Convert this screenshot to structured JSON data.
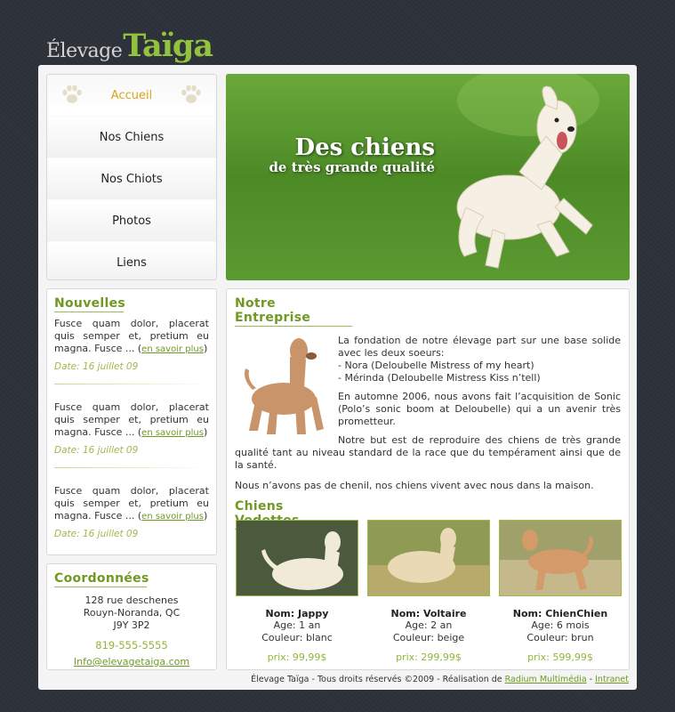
{
  "logo": {
    "part1": "Élevage",
    "part2": "Taïga"
  },
  "nav": [
    {
      "label": "Accueil",
      "active": true
    },
    {
      "label": "Nos Chiens"
    },
    {
      "label": "Nos Chiots"
    },
    {
      "label": "Photos"
    },
    {
      "label": "Liens"
    }
  ],
  "hero": {
    "title": "Des chiens",
    "subtitle": "de très grande qualité"
  },
  "news": {
    "title": "Nouvelles",
    "items": [
      {
        "text": "Fusce quam dolor, placerat quis semper et, pretium eu magna. Fusce ... (",
        "link": "en savoir plus",
        "close": ")",
        "date": "Date: 16 juillet 09"
      },
      {
        "text": "Fusce quam dolor, placerat quis semper et, pretium eu magna. Fusce ... (",
        "link": "en savoir plus",
        "close": ")",
        "date": "Date: 16 juillet 09"
      },
      {
        "text": "Fusce quam dolor, placerat quis semper et, pretium eu magna. Fusce ... (",
        "link": "en savoir plus",
        "close": ")",
        "date": "Date: 16 juillet 09"
      }
    ]
  },
  "contact": {
    "title": "Coordonnées",
    "address1": "128 rue deschenes",
    "address2": "Rouyn-Noranda, QC",
    "postal": "J9Y 3P2",
    "phone": "819-555-5555",
    "email": "Info@elevagetaiga.com"
  },
  "about": {
    "title": "Notre Entreprise",
    "p1": "La fondation de notre élevage part sur une base solide avec les deux soeurs:",
    "li1": "- Nora (Deloubelle Mistress of my heart)",
    "li2": "- Mérinda (Deloubelle Mistress Kiss n’tell)",
    "p2": "En automne 2006, nous avons fait l’acquisition de Sonic (Polo’s sonic boom at Deloubelle) qui a un avenir très prometteur.",
    "p3": "Notre but est de reproduire des chiens de très grande qualité tant au niveau standard de la race que du tempérament ainsi que de la santé.",
    "p4": "Nous n’avons pas de chenil, nos chiens vivent avec nous dans la maison."
  },
  "featured": {
    "title": "Chiens Vedettes",
    "dogs": [
      {
        "name": "Nom: Jappy",
        "age": "Age: 1 an",
        "color": "Couleur: blanc",
        "price": "prix: 99,99$"
      },
      {
        "name": "Nom: Voltaire",
        "age": "Age: 2 an",
        "color": "Couleur: beige",
        "price": "prix: 299,99$"
      },
      {
        "name": "Nom: ChienChien",
        "age": "Age: 6 mois",
        "color": "Couleur: brun",
        "price": "prix: 599,99$"
      }
    ]
  },
  "footer": {
    "text": "Élevage Taïga - Tous droits réservés ©2009 - Réalisation de ",
    "link1": "Radium Multimédia",
    "sep": " - ",
    "link2": "Intranet"
  },
  "colors": {
    "accent": "#6f9a22",
    "brand_green": "#93c23e",
    "active_nav": "#d7a51e"
  }
}
